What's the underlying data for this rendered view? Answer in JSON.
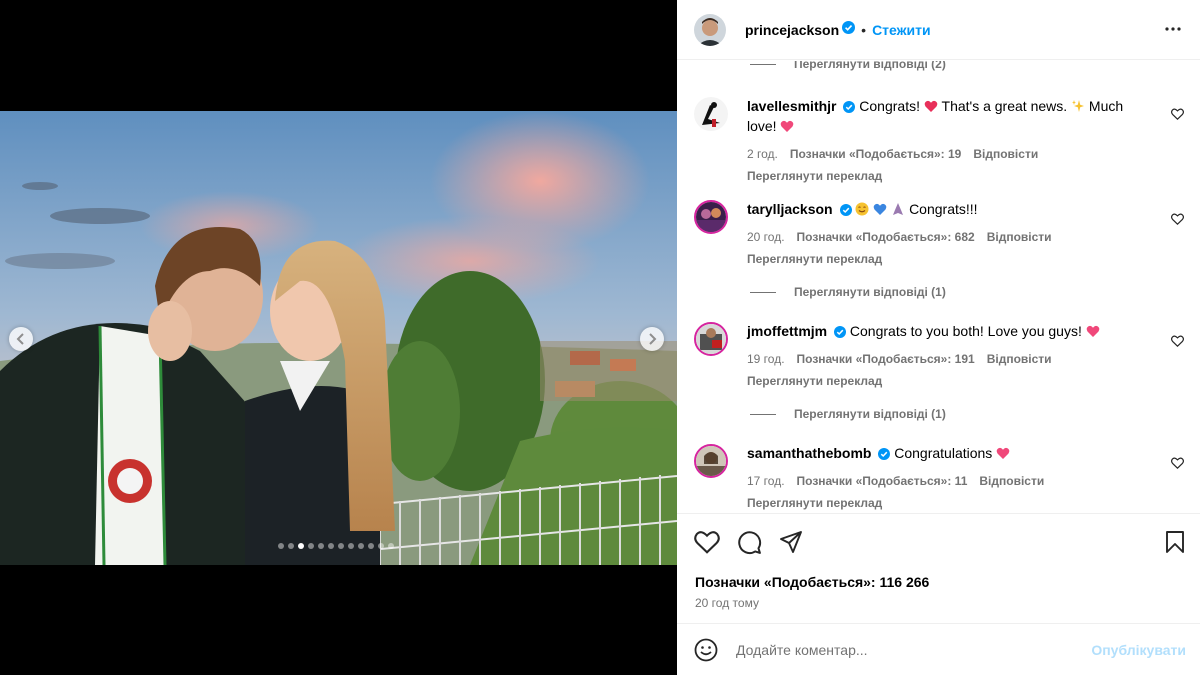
{
  "post": {
    "author": "princejackson",
    "follow_label": "Стежити",
    "separator": "•",
    "likes_text": "Позначки «Подобається»: 116 266",
    "time_ago": "20 год тому",
    "carousel": {
      "slide_count": 12,
      "active_index": 2
    }
  },
  "replies_top": "Переглянути відповіді (2)",
  "comments": [
    {
      "user": "lavellesmithjr",
      "text_parts": [
        "Congrats! ",
        " That's a great news. ",
        " Much love! "
      ],
      "time": "2 год.",
      "likes": "Позначки «Подобається»: 19",
      "reply": "Відповісти",
      "translate": "Переглянути переклад",
      "replies": ""
    },
    {
      "user": "tarylljackson",
      "text": "Congrats!!!",
      "time": "20 год.",
      "likes": "Позначки «Подобається»: 682",
      "reply": "Відповісти",
      "translate": "Переглянути переклад",
      "replies": "Переглянути відповіді (1)"
    },
    {
      "user": "jmoffettmjm",
      "text": "Congrats to you both! Love you guys! ",
      "time": "19 год.",
      "likes": "Позначки «Подобається»: 191",
      "reply": "Відповісти",
      "translate": "Переглянути переклад",
      "replies": "Переглянути відповіді (1)"
    },
    {
      "user": "samanthathebomb",
      "text": "Congratulations ",
      "time": "17 год.",
      "likes": "Позначки «Подобається»: 11",
      "reply": "Відповісти",
      "translate": "Переглянути переклад",
      "replies": ""
    }
  ],
  "add_comment": {
    "placeholder": "Додайте коментар...",
    "publish_label": "Опублікувати"
  },
  "colors": {
    "accent": "#0095f6",
    "muted": "#737373",
    "heart": "#ed4956",
    "publish_disabled": "#b2dffc"
  }
}
